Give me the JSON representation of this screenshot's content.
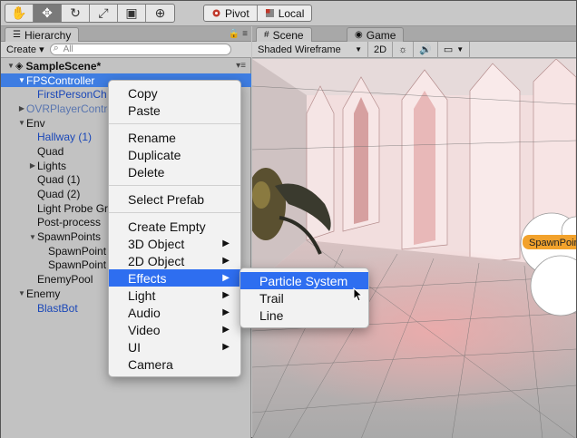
{
  "toolbar": {
    "tools": [
      {
        "name": "hand-tool",
        "glyph": "✋",
        "active": false
      },
      {
        "name": "move-tool",
        "glyph": "✥",
        "active": true
      },
      {
        "name": "rotate-tool",
        "glyph": "↻",
        "active": false
      },
      {
        "name": "scale-tool",
        "glyph": "⤢",
        "active": false
      },
      {
        "name": "rect-tool",
        "glyph": "▣",
        "active": false
      },
      {
        "name": "transform-tool",
        "glyph": "⊕",
        "active": false
      }
    ],
    "pivot_label": "Pivot",
    "local_label": "Local"
  },
  "hierarchy": {
    "tab_label": "Hierarchy",
    "create_label": "Create ▾",
    "search_placeholder": "All",
    "rows": [
      {
        "label": "SampleScene*",
        "indent": 0,
        "arrow": "▼",
        "style": "scene"
      },
      {
        "label": "FPSController",
        "indent": 1,
        "arrow": "▼",
        "style": "selected"
      },
      {
        "label": "FirstPersonCh",
        "indent": 2,
        "arrow": "",
        "style": "blue"
      },
      {
        "label": "OVRPlayerContro",
        "indent": 1,
        "arrow": "▶",
        "style": "muted-blue"
      },
      {
        "label": "Env",
        "indent": 1,
        "arrow": "▼",
        "style": "normal"
      },
      {
        "label": "Hallway (1)",
        "indent": 2,
        "arrow": "",
        "style": "blue"
      },
      {
        "label": "Quad",
        "indent": 2,
        "arrow": "",
        "style": "normal"
      },
      {
        "label": "Lights",
        "indent": 2,
        "arrow": "▶",
        "style": "normal"
      },
      {
        "label": "Quad (1)",
        "indent": 2,
        "arrow": "",
        "style": "normal"
      },
      {
        "label": "Quad (2)",
        "indent": 2,
        "arrow": "",
        "style": "normal"
      },
      {
        "label": "Light Probe Gr",
        "indent": 2,
        "arrow": "",
        "style": "normal"
      },
      {
        "label": "Post-process",
        "indent": 2,
        "arrow": "",
        "style": "normal"
      },
      {
        "label": "SpawnPoints",
        "indent": 2,
        "arrow": "▼",
        "style": "normal"
      },
      {
        "label": "SpawnPoint",
        "indent": 3,
        "arrow": "",
        "style": "normal"
      },
      {
        "label": "SpawnPoint",
        "indent": 3,
        "arrow": "",
        "style": "normal"
      },
      {
        "label": "EnemyPool",
        "indent": 2,
        "arrow": "",
        "style": "normal"
      },
      {
        "label": "Enemy",
        "indent": 1,
        "arrow": "▼",
        "style": "normal"
      },
      {
        "label": "BlastBot",
        "indent": 2,
        "arrow": "",
        "style": "blue"
      }
    ]
  },
  "scene": {
    "tab_scene": "Scene",
    "tab_game": "Game",
    "shading_mode": "Shaded Wireframe",
    "mode_2d": "2D",
    "spawn_label": "SpawnPoint"
  },
  "context_menu": {
    "items": [
      {
        "label": "Copy"
      },
      {
        "label": "Paste"
      },
      {
        "sep": true
      },
      {
        "label": "Rename"
      },
      {
        "label": "Duplicate"
      },
      {
        "label": "Delete"
      },
      {
        "sep": true
      },
      {
        "label": "Select Prefab"
      },
      {
        "sep": true
      },
      {
        "label": "Create Empty"
      },
      {
        "label": "3D Object",
        "sub": true
      },
      {
        "label": "2D Object",
        "sub": true
      },
      {
        "label": "Effects",
        "sub": true,
        "hl": true
      },
      {
        "label": "Light",
        "sub": true
      },
      {
        "label": "Audio",
        "sub": true
      },
      {
        "label": "Video",
        "sub": true
      },
      {
        "label": "UI",
        "sub": true
      },
      {
        "label": "Camera"
      }
    ]
  },
  "effects_submenu": {
    "items": [
      {
        "label": "Particle System",
        "hl": true
      },
      {
        "label": "Trail"
      },
      {
        "label": "Line"
      }
    ]
  },
  "colors": {
    "selection": "#3e7de2",
    "menu_highlight": "#2e6ef0",
    "prefab_blue": "#1a47b8",
    "spawn_badge": "#f2a22c"
  }
}
